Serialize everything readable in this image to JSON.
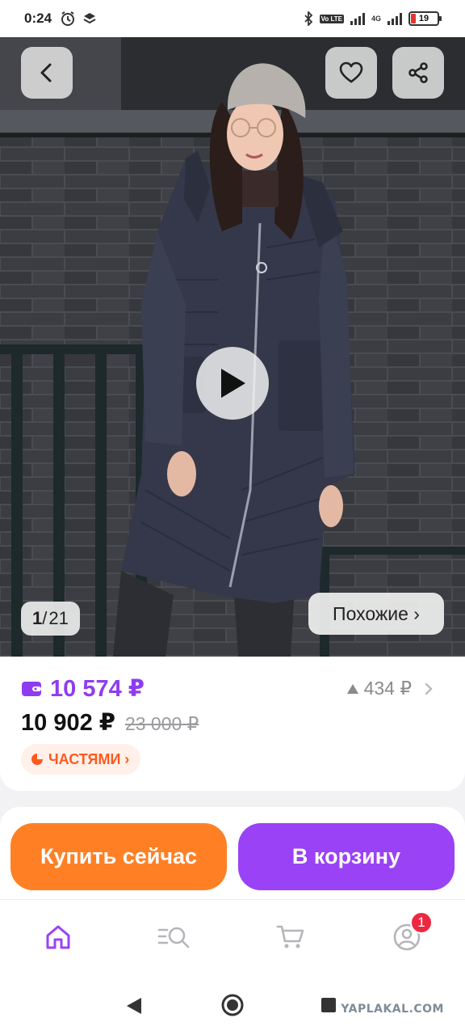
{
  "status_bar": {
    "time": "0:24",
    "volte_badge": "Vo LTE",
    "network": "4G",
    "battery": "19"
  },
  "photo": {
    "counter_current": "1",
    "counter_total": "21",
    "similar_label": "Похожие ›"
  },
  "price": {
    "wallet_price": "10 574 ₽",
    "price_drop": "434 ₽",
    "current_price": "10 902 ₽",
    "old_price": "23 000 ₽",
    "installments_label": "ЧАСТЯМИ ›"
  },
  "actions": {
    "buy_now": "Купить сейчас",
    "add_to_cart": "В корзину"
  },
  "bottom_nav": {
    "profile_badge": "1"
  },
  "watermark": "YAPLAKAL.COM",
  "colors": {
    "accent_purple": "#9a42f5",
    "accent_orange": "#ff8024",
    "badge_red": "#ee2740"
  }
}
